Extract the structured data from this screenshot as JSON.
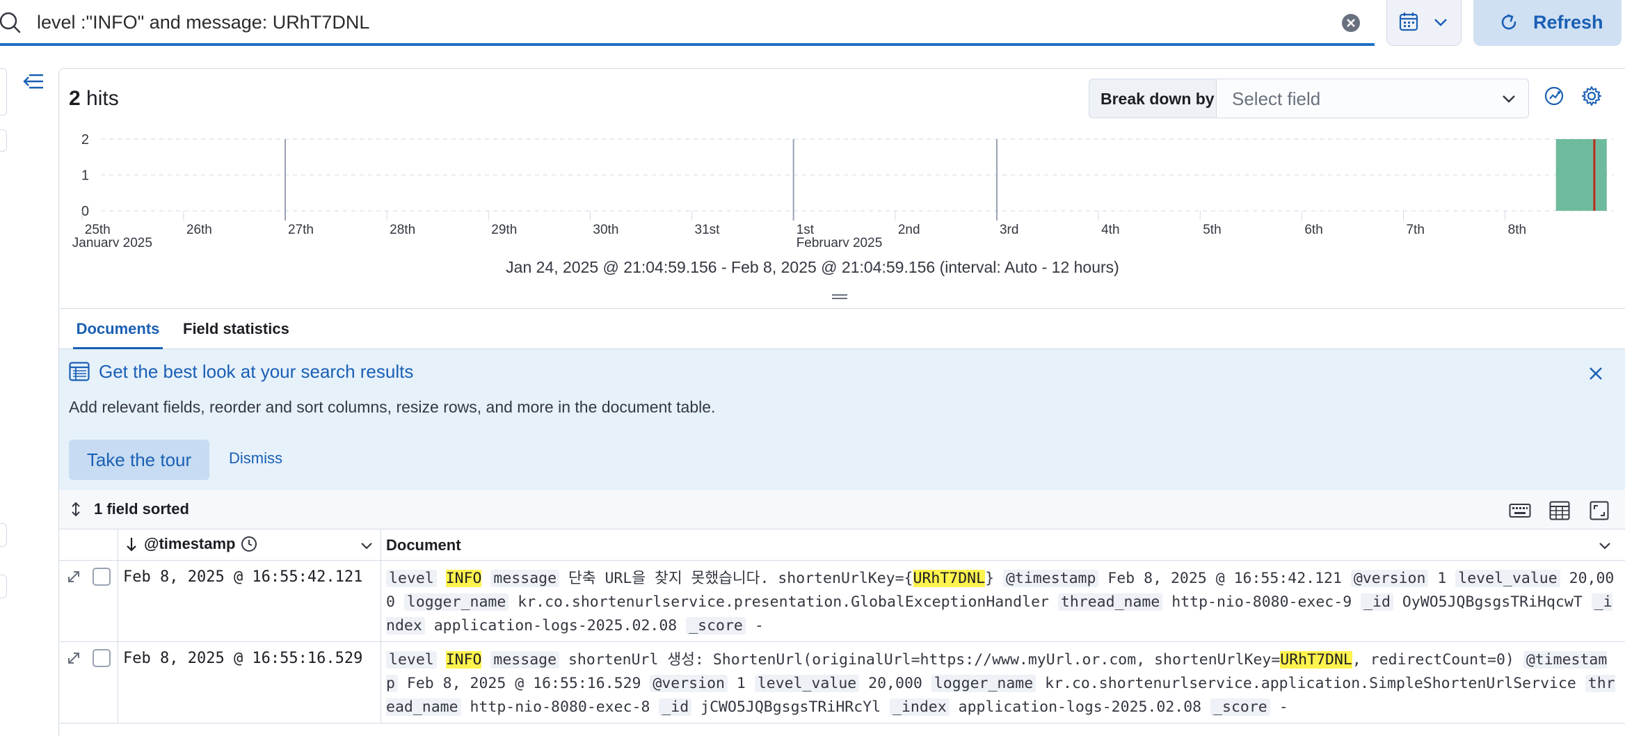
{
  "query": {
    "text": "level :\"INFO\" and message: URhT7DNL"
  },
  "toolbar": {
    "refresh_label": "Refresh"
  },
  "hits": {
    "count": "2",
    "label": "hits"
  },
  "breakdown": {
    "label": "Break down by",
    "placeholder": "Select field"
  },
  "chart_data": {
    "type": "bar",
    "x_ticks": [
      "25th",
      "26th",
      "27th",
      "28th",
      "29th",
      "30th",
      "31st",
      "1st",
      "2nd",
      "3rd",
      "4th",
      "5th",
      "6th",
      "7th",
      "8th"
    ],
    "x_sublabels": {
      "25th": "January 2025",
      "1st": "February 2025"
    },
    "x_tick_dates": [
      "2025-01-25",
      "2025-01-26",
      "2025-01-27",
      "2025-01-28",
      "2025-01-29",
      "2025-01-30",
      "2025-01-31",
      "2025-02-01",
      "2025-02-02",
      "2025-02-03",
      "2025-02-04",
      "2025-02-05",
      "2025-02-06",
      "2025-02-07",
      "2025-02-08"
    ],
    "y_ticks": [
      0,
      1,
      2
    ],
    "ylim": [
      0,
      2
    ],
    "bars": [
      {
        "start": "2025-02-08 12:00",
        "end": "2025-02-09 00:00",
        "count": 2
      }
    ],
    "current_time_marker": "2025-02-08 21:04",
    "color": "#6dbb9c",
    "marker_color": "#bd271e"
  },
  "time_range": "Jan 24, 2025 @ 21:04:59.156 - Feb 8, 2025 @ 21:04:59.156 (interval: Auto - 12 hours)",
  "tabs": [
    {
      "label": "Documents",
      "active": true
    },
    {
      "label": "Field statistics",
      "active": false
    }
  ],
  "callout": {
    "title": "Get the best look at your search results",
    "body": "Add relevant fields, reorder and sort columns, resize rows, and more in the document table.",
    "tour_label": "Take the tour",
    "dismiss_label": "Dismiss"
  },
  "grid": {
    "sorted_label": "1 field sorted",
    "columns": [
      "@timestamp",
      "Document"
    ],
    "rows": [
      {
        "timestamp": "Feb 8, 2025 @ 16:55:42.121",
        "doc": [
          {
            "k": "level"
          },
          {
            "h": "INFO"
          },
          {
            "k": "message"
          },
          {
            "v": "단축 URL을 찾지 못했습니다. shortenUrlKey={"
          },
          {
            "h": "URhT7DNL"
          },
          {
            "v": "}"
          },
          {
            "k": "@timestamp"
          },
          {
            "v": "Feb 8, 2025 @ 16:55:42.121"
          },
          {
            "k": "@version"
          },
          {
            "v": "1"
          },
          {
            "k": "level_value"
          },
          {
            "v": "20,000"
          },
          {
            "k": "logger_name"
          },
          {
            "v": "kr.co.shortenurlservice.presentation.GlobalExceptionHandler"
          },
          {
            "k": "thread_name"
          },
          {
            "v": "http-nio-8080-exec-9"
          },
          {
            "k": "_id"
          },
          {
            "v": "OyWO5JQBgsgsTRiHqcwT"
          },
          {
            "k": "_index"
          },
          {
            "v": "application-logs-2025.02.08"
          },
          {
            "k": "_score"
          },
          {
            "v": " -"
          }
        ]
      },
      {
        "timestamp": "Feb 8, 2025 @ 16:55:16.529",
        "doc": [
          {
            "k": "level"
          },
          {
            "h": "INFO"
          },
          {
            "k": "message"
          },
          {
            "v": "shortenUrl 생성: ShortenUrl(originalUrl=https://www.myUrl.or.com, shortenUrlKey="
          },
          {
            "h": "URhT7DNL"
          },
          {
            "v": ", redirectCount=0)"
          },
          {
            "k": "@timestamp"
          },
          {
            "v": "Feb 8, 2025 @ 16:55:16.529"
          },
          {
            "k": "@version"
          },
          {
            "v": "1"
          },
          {
            "k": "level_value"
          },
          {
            "v": "20,000"
          },
          {
            "k": "logger_name"
          },
          {
            "v": "kr.co.shortenurlservice.application.SimpleShortenUrlService"
          },
          {
            "k": "thread_name"
          },
          {
            "v": "http-nio-8080-exec-8"
          },
          {
            "k": "_id"
          },
          {
            "v": "jCWO5JQBgsgsTRiHRcYl"
          },
          {
            "k": "_index"
          },
          {
            "v": "application-logs-2025.02.08"
          },
          {
            "k": "_score"
          },
          {
            "v": " -"
          }
        ]
      }
    ]
  }
}
